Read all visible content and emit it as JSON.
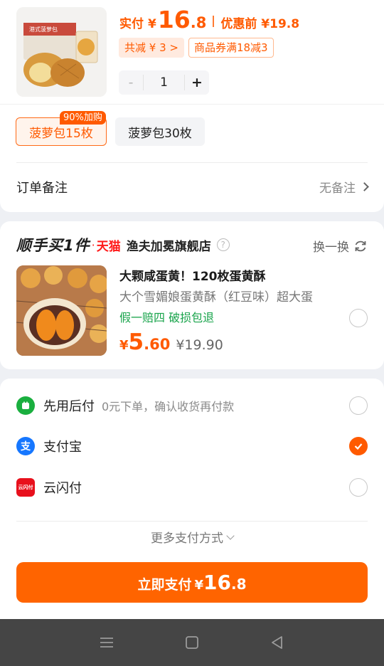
{
  "product": {
    "paid_label": "实付",
    "yen": "¥",
    "paid_int": "16",
    "paid_dec": ".8",
    "original_label": "优惠前 ¥19.8",
    "tag_total_discount": "共减 ¥ 3 >",
    "tag_coupon": "商品券满18减3",
    "qty_minus": "-",
    "qty_value": "1",
    "qty_plus": "+",
    "image_icon": "pineapple-bun-product-image",
    "package_text": "港式菠萝包"
  },
  "specs": {
    "selected": "菠萝包15枚",
    "selected_badge": "90%加购",
    "other": "菠萝包30枚"
  },
  "remark": {
    "label": "订单备注",
    "value": "无备注"
  },
  "buy_together": {
    "title": "顺手买1件",
    "dot": "·",
    "tmall": "天猫",
    "store": "渔夫加冕旗舰店",
    "help": "?",
    "swap_label": "换一换",
    "item_name": "大颗咸蛋黄！120枚蛋黄酥",
    "item_desc": "大个雪媚娘蛋黄酥（红豆味）超大蛋",
    "guarantee": "假一赔四  破损包退",
    "price_yen": "¥",
    "price_int": "5",
    "price_dec": ".60",
    "price_orig": "¥19.90",
    "image_icon": "egg-yolk-pastry-image"
  },
  "payment": {
    "options": [
      {
        "name": "先用后付",
        "sub": "0元下单，确认收货再付款",
        "icon": "pay-later-icon",
        "color": "#1aaf3f",
        "selected": false
      },
      {
        "name": "支付宝",
        "sub": "",
        "icon": "alipay-icon",
        "color": "#1677ff",
        "selected": true
      },
      {
        "name": "云闪付",
        "sub": "",
        "icon": "unionpay-quickpass-icon",
        "color": "#e8101c",
        "selected": false
      }
    ],
    "more_label": "更多支付方式",
    "pay_label": "立即支付",
    "pay_yen": "¥",
    "pay_int": "16",
    "pay_dec": ".8",
    "accent": "#ff6400"
  },
  "nav": [
    "menu-icon",
    "home-square-icon",
    "back-triangle-icon"
  ]
}
